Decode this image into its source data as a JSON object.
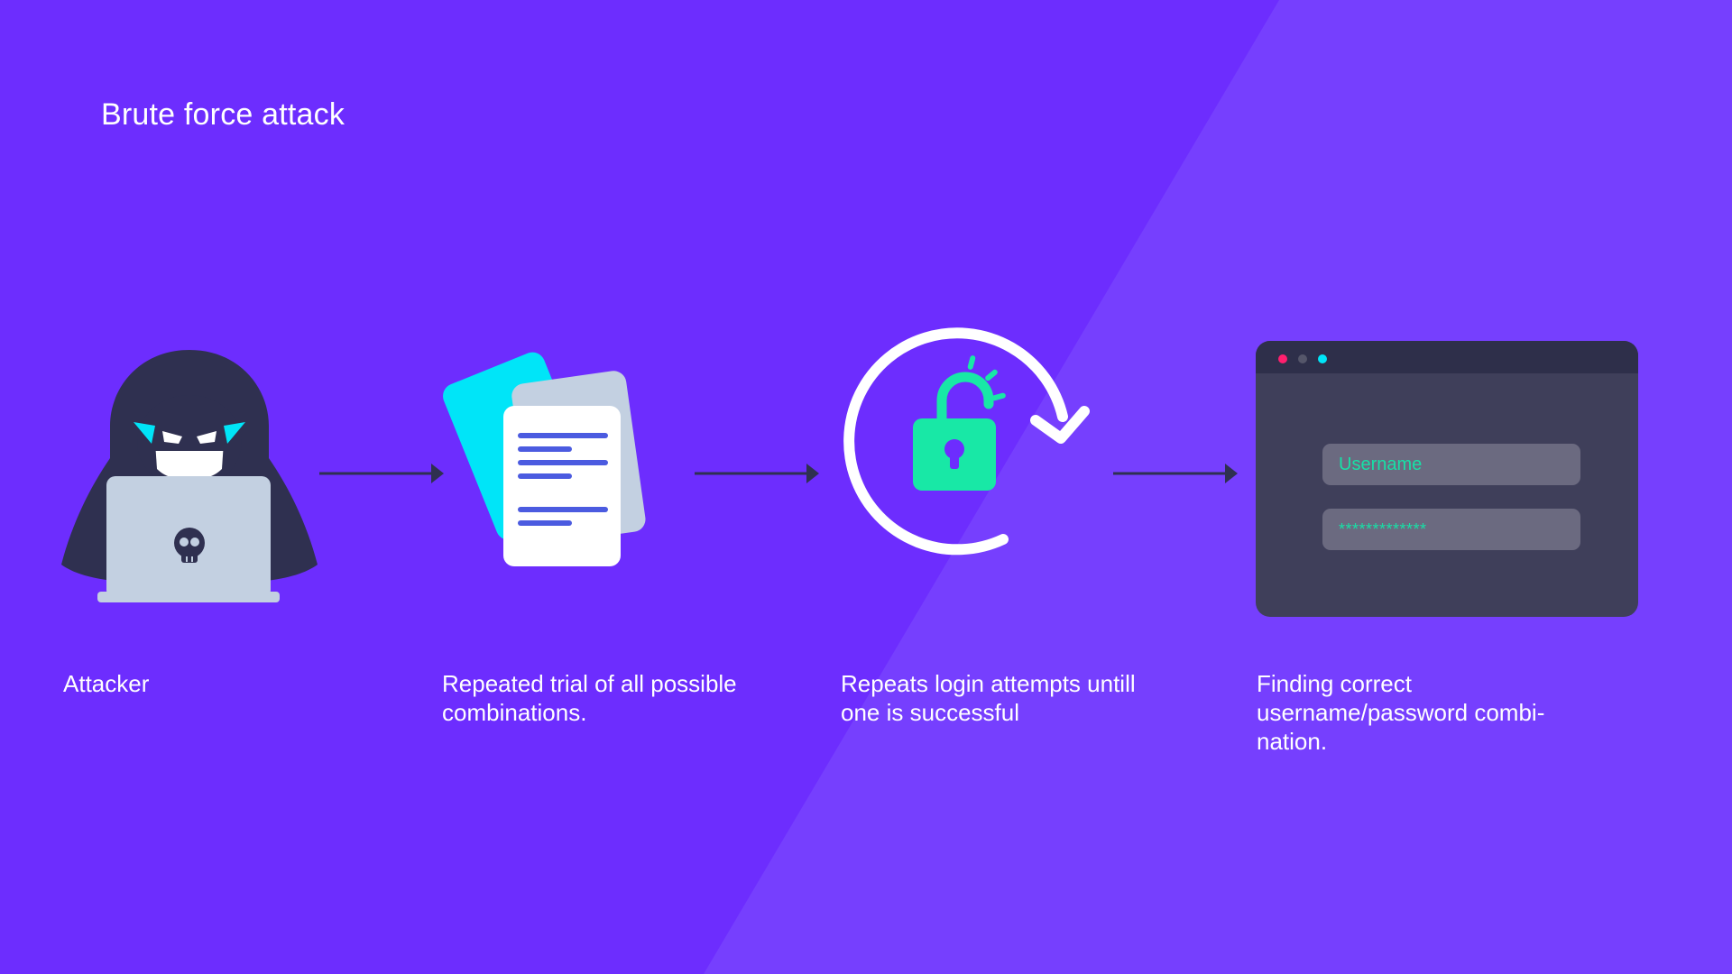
{
  "title": "Brute force attack",
  "colors": {
    "background": "#6d2dfe",
    "background_right": "#763ffe",
    "dark": "#2f3050",
    "cyan": "#00e5f8",
    "mint": "#18e8a6",
    "laptop": "#c3d0e1",
    "doc_lines": "#4b5be0",
    "browser_body": "#3f3f5a",
    "browser_bar": "#2e2f4a",
    "dot_red": "#ff1f6e",
    "dot_gray": "#55566a",
    "dot_cyan": "#00e5f8"
  },
  "steps": [
    {
      "icon": "hooded-hacker-laptop-icon",
      "caption": "Attacker"
    },
    {
      "icon": "stacked-documents-icon",
      "caption": "Repeated trial of all possible combinations."
    },
    {
      "icon": "rotating-unlock-icon",
      "caption": "Repeats login attempts untill one is successful"
    },
    {
      "icon": "browser-login-form-icon",
      "caption": "Finding correct username/password combi-nation."
    }
  ],
  "login_form": {
    "username_placeholder": "Username",
    "password_value": "*************"
  }
}
